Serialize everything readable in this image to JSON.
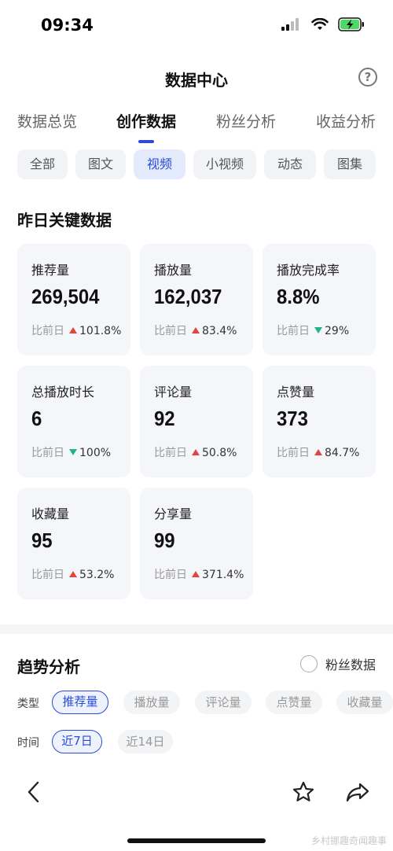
{
  "status_bar": {
    "time": "09:34"
  },
  "nav": {
    "title": "数据中心",
    "help_icon": "?"
  },
  "tabs": [
    {
      "label": "数据总览",
      "active": false
    },
    {
      "label": "创作数据",
      "active": true
    },
    {
      "label": "粉丝分析",
      "active": false
    },
    {
      "label": "收益分析",
      "active": false
    }
  ],
  "content_types": [
    {
      "label": "全部",
      "active": false
    },
    {
      "label": "图文",
      "active": false
    },
    {
      "label": "视频",
      "active": true
    },
    {
      "label": "小视频",
      "active": false
    },
    {
      "label": "动态",
      "active": false
    },
    {
      "label": "图集",
      "active": false
    }
  ],
  "key_data": {
    "title": "昨日关键数据",
    "compare_label": "比前日",
    "cards": [
      {
        "label": "推荐量",
        "value": "269,504",
        "change": "101.8%",
        "direction": "up"
      },
      {
        "label": "播放量",
        "value": "162,037",
        "change": "83.4%",
        "direction": "up"
      },
      {
        "label": "播放完成率",
        "value": "8.8%",
        "change": "29%",
        "direction": "down"
      },
      {
        "label": "总播放时长",
        "value": "6",
        "change": "100%",
        "direction": "down"
      },
      {
        "label": "评论量",
        "value": "92",
        "change": "50.8%",
        "direction": "up"
      },
      {
        "label": "点赞量",
        "value": "373",
        "change": "84.7%",
        "direction": "up"
      },
      {
        "label": "收藏量",
        "value": "95",
        "change": "53.2%",
        "direction": "up"
      },
      {
        "label": "分享量",
        "value": "99",
        "change": "371.4%",
        "direction": "up"
      }
    ]
  },
  "trend": {
    "title": "趋势分析",
    "fans_toggle_label": "粉丝数据",
    "type_label": "类型",
    "type_options": [
      {
        "label": "推荐量",
        "active": true
      },
      {
        "label": "播放量",
        "active": false
      },
      {
        "label": "评论量",
        "active": false
      },
      {
        "label": "点赞量",
        "active": false
      },
      {
        "label": "收藏量",
        "active": false
      }
    ],
    "time_label": "时间",
    "time_options": [
      {
        "label": "近7日",
        "active": true
      },
      {
        "label": "近14日",
        "active": false
      }
    ]
  },
  "bottom_bar": {
    "watermark": "乡村挪趣奇闻趣事"
  },
  "colors": {
    "accent": "#2b4bd8",
    "up": "#e0453f",
    "down": "#1fb28e",
    "card_bg": "#f5f6f9"
  }
}
